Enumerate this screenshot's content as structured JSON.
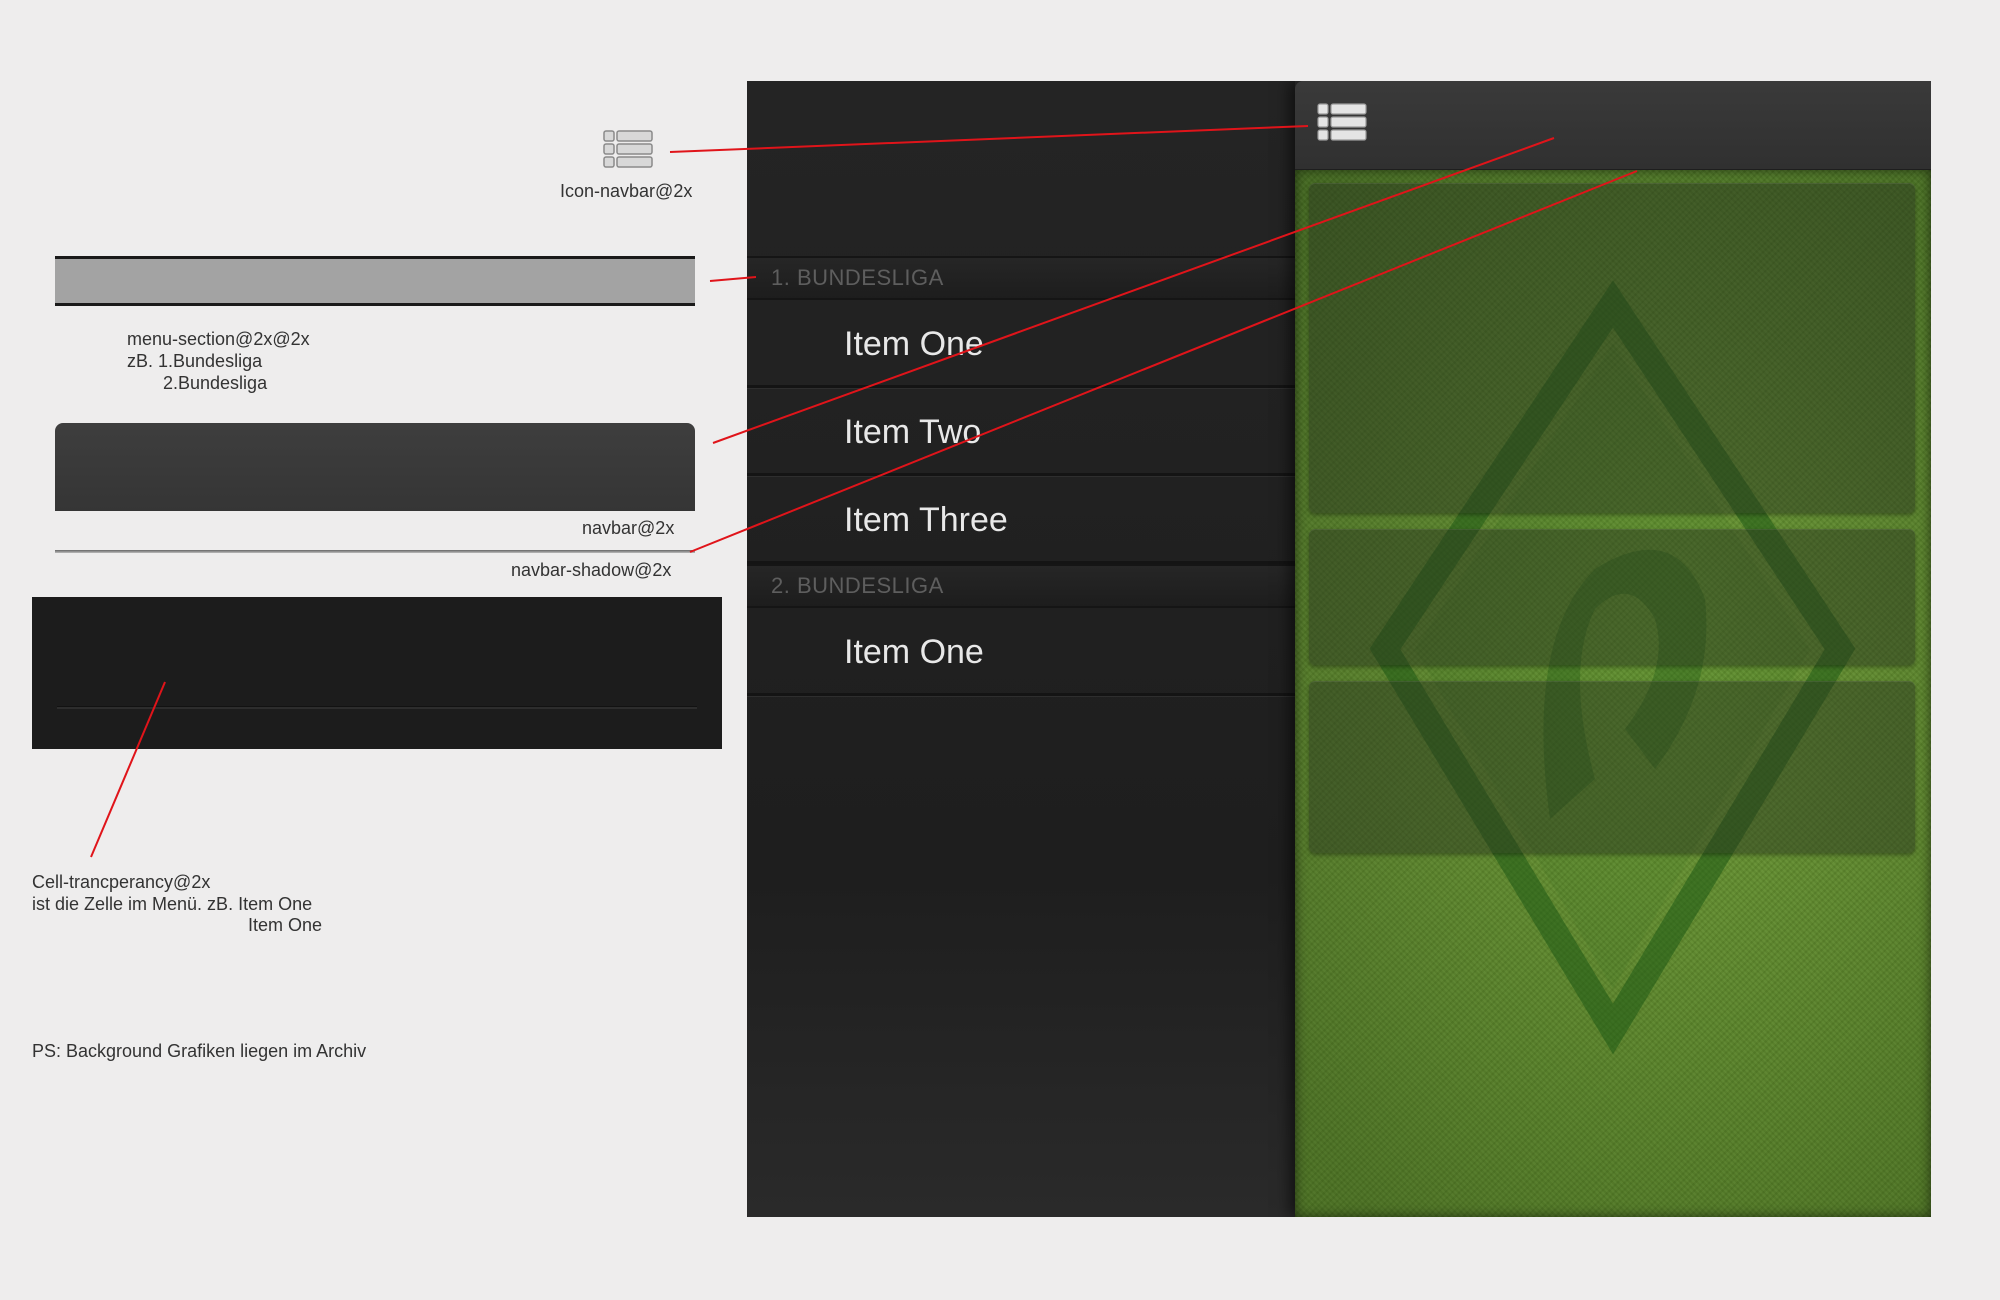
{
  "annotations": {
    "icon_navbar": "Icon-navbar@2x",
    "menu_section_title": "menu-section@2x@2x",
    "menu_section_line2": "zB.  1.Bundesliga",
    "menu_section_line3": "2.Bundesliga",
    "navbar": "navbar@2x",
    "navbar_shadow": "navbar-shadow@2x",
    "cell_line1": "Cell-trancperancy@2x",
    "cell_line2": "ist die Zelle im Menü. zB. Item One",
    "cell_line3": "Item One",
    "ps_note": "PS: Background Grafiken liegen im Archiv"
  },
  "menu": {
    "sections": [
      {
        "title": "1. BUNDESLIGA",
        "items": [
          "Item One",
          "Item Two",
          "Item Three"
        ]
      },
      {
        "title": "2. BUNDESLIGA",
        "items": [
          "Item One"
        ]
      }
    ]
  },
  "icons": {
    "navbar_icon": "list-icon"
  },
  "colors": {
    "annotation_line": "#e0141a",
    "page_background": "#eeeded",
    "grass": "#6a9a30",
    "menu_background": "#222222"
  }
}
